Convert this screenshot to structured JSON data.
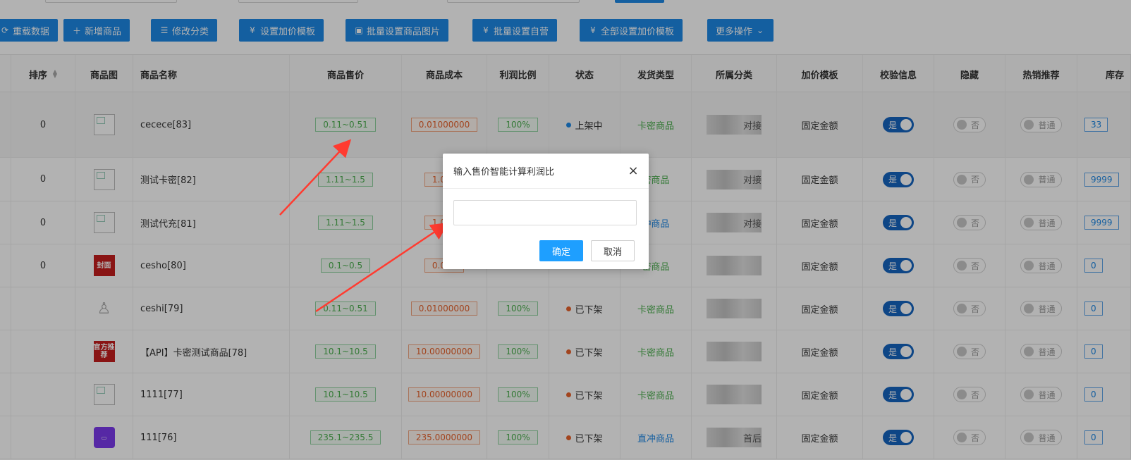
{
  "toolbar": {
    "buttons": [
      {
        "icon": "reload-icon",
        "label": "重载数据"
      },
      {
        "icon": "plus-icon",
        "label": "新增商品"
      },
      {
        "icon": "sliders-icon",
        "label": "修改分类"
      },
      {
        "icon": "yen-circle-icon",
        "label": "设置加价模板"
      },
      {
        "icon": "image-icon",
        "label": "批量设置商品图片"
      },
      {
        "icon": "yen-circle-icon",
        "label": "批量设置自营"
      },
      {
        "icon": "yen-circle-icon",
        "label": "全部设置加价模板"
      },
      {
        "icon": "chevron-down-icon",
        "label": "更多操作"
      }
    ]
  },
  "table": {
    "headers": [
      "排序",
      "商品图",
      "商品名称",
      "商品售价",
      "商品成本",
      "利润比例",
      "状态",
      "发货类型",
      "所属分类",
      "加价模板",
      "校验信息",
      "隐藏",
      "热销推荐",
      "库存"
    ],
    "rows": [
      {
        "sort": "0",
        "img": "placeholder",
        "name": "cecece[83]",
        "price": "0.11~0.51",
        "cost": "0.01000000",
        "profit": "100%",
        "status": "上架中",
        "status_color": "#1e88e5",
        "ship": "卡密商品",
        "ship_color": "green",
        "category": "对接",
        "template": "固定金额",
        "verify": "是",
        "hide": "否",
        "hot": "普通",
        "stock": "33"
      },
      {
        "sort": "0",
        "img": "placeholder",
        "name": "测试卡密[82]",
        "price": "1.11~1.5",
        "cost": "1.000",
        "profit": "",
        "status": "",
        "status_color": "#1e88e5",
        "ship": "密商品",
        "ship_color": "green",
        "category": "对接",
        "template": "固定金额",
        "verify": "是",
        "hide": "否",
        "hot": "普通",
        "stock": "9999"
      },
      {
        "sort": "0",
        "img": "placeholder",
        "name": "测试代充[81]",
        "price": "1.11~1.5",
        "cost": "1.000",
        "profit": "",
        "status": "",
        "status_color": "#1e88e5",
        "ship": "冲商品",
        "ship_color": "blue",
        "category": "对接",
        "template": "固定金额",
        "verify": "是",
        "hide": "否",
        "hot": "普通",
        "stock": "9999"
      },
      {
        "sort": "0",
        "img": "red-seal",
        "img_text": "封面",
        "name": "cesho[80]",
        "price": "0.1~0.5",
        "cost": "0.000",
        "profit": "",
        "status": "",
        "status_color": "#1e88e5",
        "ship": "密商品",
        "ship_color": "green",
        "category": "",
        "template": "固定金额",
        "verify": "是",
        "hide": "否",
        "hot": "普通",
        "stock": "0"
      },
      {
        "sort": "",
        "img": "figure",
        "name": "ceshi[79]",
        "price": "0.11~0.51",
        "cost": "0.01000000",
        "profit": "100%",
        "status": "已下架",
        "status_color": "#e8622c",
        "ship": "卡密商品",
        "ship_color": "green",
        "category": "",
        "template": "固定金额",
        "verify": "是",
        "hide": "否",
        "hot": "普通",
        "stock": "0"
      },
      {
        "sort": "",
        "img": "red-badge",
        "img_text": "官方推荐",
        "name": "【API】卡密测试商品[78]",
        "price": "10.1~10.5",
        "cost": "10.00000000",
        "profit": "100%",
        "status": "已下架",
        "status_color": "#e8622c",
        "ship": "卡密商品",
        "ship_color": "green",
        "category": "",
        "template": "固定金额",
        "verify": "是",
        "hide": "否",
        "hot": "普通",
        "stock": "0"
      },
      {
        "sort": "",
        "img": "placeholder",
        "name": "1111[77]",
        "price": "10.1~10.5",
        "cost": "10.00000000",
        "profit": "100%",
        "status": "已下架",
        "status_color": "#e8622c",
        "ship": "卡密商品",
        "ship_color": "green",
        "category": "",
        "template": "固定金额",
        "verify": "是",
        "hide": "否",
        "hot": "普通",
        "stock": "0"
      },
      {
        "sort": "",
        "img": "purple-card",
        "name": "111[76]",
        "price": "235.1~235.5",
        "cost": "235.0000000",
        "profit": "100%",
        "status": "已下架",
        "status_color": "#e8622c",
        "ship": "直冲商品",
        "ship_color": "blue",
        "category": "首后",
        "template": "固定金额",
        "verify": "是",
        "hide": "否",
        "hot": "普通",
        "stock": "0"
      }
    ]
  },
  "dialog": {
    "title": "输入售价智能计算利润比",
    "input_value": "",
    "ok_label": "确定",
    "cancel_label": "取消"
  },
  "colors": {
    "primary": "#1e88e5",
    "dialog_ok": "#1e9fff",
    "price_green": "#4caf50",
    "cost_orange": "#e8622c",
    "arrow_red": "#ff3b30"
  }
}
